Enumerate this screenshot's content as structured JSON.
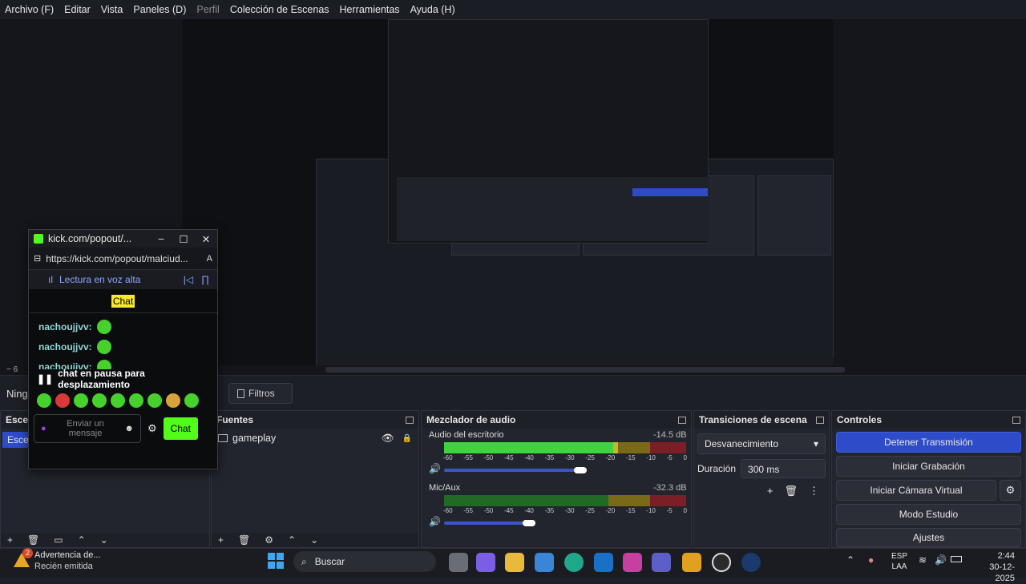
{
  "menu": [
    "Archivo (F)",
    "Editar",
    "Vista",
    "Paneles (D)",
    "Perfil",
    "Colección de Escenas",
    "Herramientas",
    "Ayuda (H)"
  ],
  "preview": {
    "zoom": "6"
  },
  "source_bar": {
    "selected": "Ningu",
    "filters_button": "Filtros"
  },
  "kick_popup": {
    "title": "kick.com/popout/...",
    "url": "https://kick.com/popout/malciud...",
    "read_aloud": "Lectura en voz alta",
    "chat_tab": "Chat",
    "messages": [
      {
        "user": "nachoujjvv:"
      },
      {
        "user": "nachoujjvv:"
      },
      {
        "user": "nachoujjvv:"
      }
    ],
    "paused_notice": "chat en pausa para desplazamiento",
    "input_placeholder": "Enviar un mensaje",
    "send_button": "Chat"
  },
  "docks": {
    "scenes": {
      "title": "Esce",
      "item": "Escen"
    },
    "sources": {
      "title": "Fuentes",
      "item": "gameplay"
    },
    "mixer": {
      "title": "Mezclador de audio",
      "channels": [
        {
          "name": "Audio del escritorio",
          "db": "-14.5 dB",
          "level": 0.72,
          "volume": 0.9
        },
        {
          "name": "Mic/Aux",
          "db": "-32.3 dB",
          "level": 0.0,
          "volume": 0.4
        }
      ],
      "ticks": [
        "-60",
        "-55",
        "-50",
        "-45",
        "-40",
        "-35",
        "-30",
        "-25",
        "-20",
        "-15",
        "-10",
        "-5",
        "0"
      ]
    },
    "transitions": {
      "title": "Transiciones de escena",
      "selected": "Desvanecimiento",
      "duration_label": "Duración",
      "duration_value": "300 ms"
    },
    "controls": {
      "title": "Controles",
      "buttons": [
        "Detener Transmisión",
        "Iniciar Grabación",
        "Iniciar Cámara Virtual",
        "Modo Estudio",
        "Ajustes"
      ]
    }
  },
  "taskbar": {
    "notification_title": "Advertencia de...",
    "notification_sub": "Recién emitida",
    "notification_badge": "2",
    "search": "Buscar",
    "lang1": "ESP",
    "lang2": "LAA",
    "time": "2:44",
    "date": "30-12-2025"
  },
  "colors": {
    "accent": "#2e4bc9",
    "meter_green": "#3fd43f",
    "meter_yellow": "#c8b72a",
    "meter_red": "#c8303a",
    "kick_green": "#53fc18"
  }
}
